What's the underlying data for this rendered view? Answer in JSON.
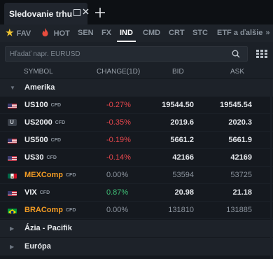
{
  "window": {
    "tab_title": "Sledovanie trhu",
    "restore_icon": "restore-window-icon",
    "close_icon": "close-icon",
    "add_tab_icon": "plus-icon"
  },
  "categories": [
    {
      "label": "FAV",
      "icon": "star-icon",
      "active": false
    },
    {
      "label": "HOT",
      "icon": "flame-icon",
      "active": false
    },
    {
      "label": "SEN",
      "active": false
    },
    {
      "label": "FX",
      "active": false
    },
    {
      "label": "IND",
      "active": true
    },
    {
      "label": "CMD",
      "active": false
    },
    {
      "label": "CRT",
      "active": false
    },
    {
      "label": "STC",
      "active": false
    },
    {
      "label": "ETF a ďalšie",
      "active": false
    }
  ],
  "search": {
    "placeholder": "Hľadať napr. EURUSD"
  },
  "columns": {
    "symbol": "SYMBOL",
    "change": "CHANGE(1D)",
    "bid": "BID",
    "ask": "ASK"
  },
  "groups": {
    "amerika": "Amerika",
    "azia": "Ázia - Pacifik",
    "europa": "Európa"
  },
  "instruments": [
    {
      "symbol": "US100",
      "type": "CFD",
      "change": "-0.27%",
      "bid": "19544.50",
      "ask": "19545.54",
      "flag": "us"
    },
    {
      "symbol": "US2000",
      "type": "CFD",
      "change": "-0.35%",
      "bid": "2019.6",
      "ask": "2020.3",
      "flag": "u"
    },
    {
      "symbol": "US500",
      "type": "CFD",
      "change": "-0.19%",
      "bid": "5661.2",
      "ask": "5661.9",
      "flag": "us"
    },
    {
      "symbol": "US30",
      "type": "CFD",
      "change": "-0.14%",
      "bid": "42166",
      "ask": "42169",
      "flag": "us"
    },
    {
      "symbol": "MEXComp",
      "type": "CFD",
      "change": "0.00%",
      "bid": "53594",
      "ask": "53725",
      "flag": "mx"
    },
    {
      "symbol": "VIX",
      "type": "CFD",
      "change": "0.87%",
      "bid": "20.98",
      "ask": "21.18",
      "flag": "us"
    },
    {
      "symbol": "BRAComp",
      "type": "CFD",
      "change": "0.00%",
      "bid": "131810",
      "ask": "131885",
      "flag": "br"
    }
  ],
  "colors": {
    "negative": "#e8474d",
    "positive": "#3fbf76",
    "closed_market": "#f39c24"
  }
}
